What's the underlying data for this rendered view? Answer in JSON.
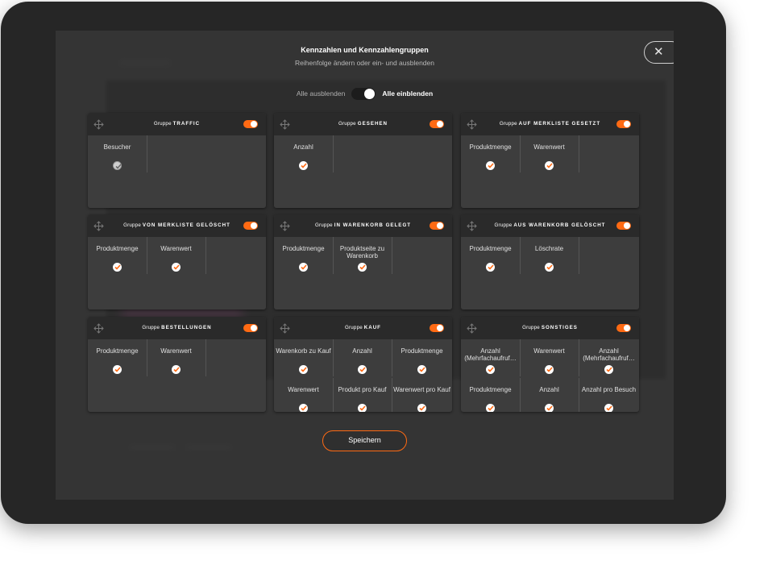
{
  "modal": {
    "title": "Kennzahlen und Kennzahlengruppen",
    "subtitle": "Reihenfolge ändern oder ein- und ausblenden",
    "close_symbol": "✕",
    "hide_all_label": "Alle ausblenden",
    "show_all_label": "Alle einblenden",
    "save_label": "Speichern"
  },
  "colors": {
    "accent": "#ff6a13",
    "card_bg": "#3d3d3d",
    "card_header_bg": "#2a2a2a"
  },
  "groups": [
    {
      "prefix": "Gruppe",
      "name": "Traffic",
      "enabled": true,
      "metrics": [
        {
          "label": "Besucher",
          "checked": true,
          "style": "grey"
        }
      ]
    },
    {
      "prefix": "Gruppe",
      "name": "Gesehen",
      "enabled": true,
      "metrics": [
        {
          "label": "Anzahl",
          "checked": true
        }
      ]
    },
    {
      "prefix": "Gruppe",
      "name": "Auf Merkliste gesetzt",
      "enabled": true,
      "metrics": [
        {
          "label": "Produktmenge",
          "checked": true
        },
        {
          "label": "Warenwert",
          "checked": true
        }
      ]
    },
    {
      "prefix": "Gruppe",
      "name": "Von Merkliste gelöscht",
      "enabled": true,
      "metrics": [
        {
          "label": "Produktmenge",
          "checked": true
        },
        {
          "label": "Warenwert",
          "checked": true
        }
      ]
    },
    {
      "prefix": "Gruppe",
      "name": "In Warenkorb gelegt",
      "enabled": true,
      "metrics": [
        {
          "label": "Produktmenge",
          "checked": true
        },
        {
          "label": "Produktseite zu Warenkorb",
          "checked": true
        }
      ]
    },
    {
      "prefix": "Gruppe",
      "name": "Aus Warenkorb gelöscht",
      "enabled": true,
      "metrics": [
        {
          "label": "Produktmenge",
          "checked": true
        },
        {
          "label": "Löschrate",
          "checked": true
        }
      ]
    },
    {
      "prefix": "Gruppe",
      "name": "Bestellungen",
      "enabled": true,
      "metrics": [
        {
          "label": "Produktmenge",
          "checked": true
        },
        {
          "label": "Warenwert",
          "checked": true
        }
      ]
    },
    {
      "prefix": "Gruppe",
      "name": "Kauf",
      "enabled": true,
      "metrics": [
        {
          "label": "Warenkorb zu Kauf",
          "checked": true
        },
        {
          "label": "Anzahl",
          "checked": true
        },
        {
          "label": "Produktmenge",
          "checked": true
        },
        {
          "label": "Warenwert",
          "checked": true
        },
        {
          "label": "Produkt pro Kauf",
          "checked": true
        },
        {
          "label": "Warenwert pro Kauf",
          "checked": true
        }
      ]
    },
    {
      "prefix": "Gruppe",
      "name": "Sonstiges",
      "enabled": true,
      "metrics": [
        {
          "label": "Anzahl (Mehrfachaufruf…",
          "checked": true
        },
        {
          "label": "Warenwert",
          "checked": true
        },
        {
          "label": "Anzahl (Mehrfachaufruf…",
          "checked": true
        },
        {
          "label": "Produktmenge",
          "checked": true
        },
        {
          "label": "Anzahl",
          "checked": true
        },
        {
          "label": "Anzahl pro Besuch",
          "checked": true
        }
      ]
    }
  ]
}
